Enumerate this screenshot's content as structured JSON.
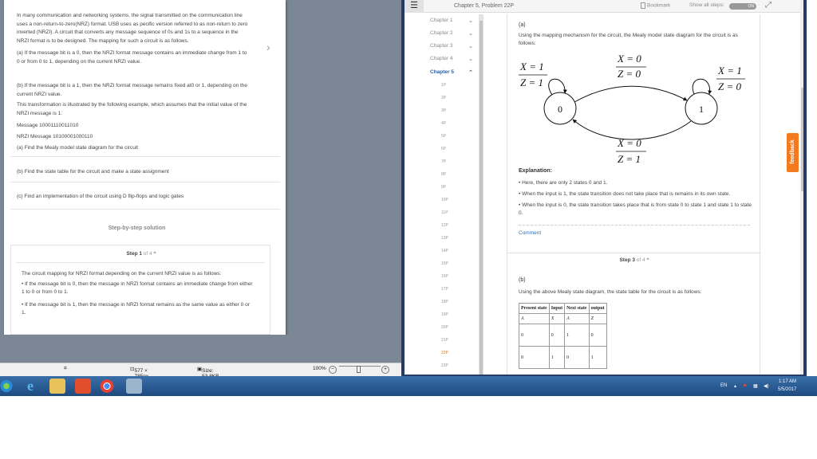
{
  "left_viewer": {
    "problem_text": {
      "intro": "In many communication and networking systems, the signal transmitted on the communication line uses a non-return-to-zero(NRZ) format. USB uses as pecific version referred to as non-return to zero inverted (NRZI). A circuit that converts any message sequence of 0s and 1s to a sequence in the NRZI format is to be designed. The mapping for such a circuit is as follows.",
      "part_a": "(a) If the message bit is a 0, then the NRZI format message contains an immediate change from 1 to 0 or from 0 to 1, depending on the current NRZI value.",
      "part_b": "(b) If the message bit is a 1, then the NRZI format message remains fixed at0 or 1, depending on the current NRZI value.",
      "illustration": "This transformation is illustrated by the following example, which assumes that the initial value of the NRZI message is 1:",
      "message": "Message 10001110011010",
      "nrzi_message": "NRZI Message  10100001000110",
      "question_a": "(a) Find the Mealy model state diagram for the circuit",
      "question_b": "(b) Find the state table for the circuit and make a state assignment",
      "question_c": "(c) Find an implementation of the circuit using D flip-flops and logic gates"
    },
    "solution_title": "Step-by-step solution",
    "step1": {
      "label": "Step 1",
      "of": "of 4",
      "p1": "The circuit mapping for NRZI format depending on the current NRZI value is as follows:",
      "p2": "• If the message bit is 0, then the message in NRZI format contains an immediate change from either 1 to 0 or from 0 to 1.",
      "p3": "• If the message bit is 1, then the message in NRZI format remains as the same value as either 0 or 1."
    },
    "status": {
      "dimensions": "577 × 785px",
      "size": "Size: 53.8KB",
      "zoom": "100%"
    }
  },
  "textbook": {
    "title": "Chapter 5, Problem 22P",
    "bookmark_label": "Bookmark",
    "show_all_steps_label": "Show all steps:",
    "toggle_label": "ON",
    "chapters": [
      "Chapter 1",
      "Chapter 2",
      "Chapter 3",
      "Chapter 4",
      "Chapter 5"
    ],
    "active_chapter": "Chapter 5",
    "problems": [
      "1P",
      "2P",
      "3P",
      "4P",
      "5P",
      "6P",
      "7P",
      "8P",
      "9P",
      "10P",
      "11P",
      "12P",
      "13P",
      "14P",
      "15P",
      "16P",
      "17P",
      "18P",
      "19P",
      "20P",
      "21P",
      "22P",
      "23P"
    ],
    "active_problem": "22P",
    "content": {
      "part_a_label": "(a)",
      "part_a_text": "Using the mapping mechanism for the circuit, the Mealy model state diagram for the circuit is as follows:",
      "diagram": {
        "state_0": "0",
        "state_1": "1",
        "self_loop_0_top": "X = 1",
        "self_loop_0_bottom": "Z = 1",
        "top_transition_top": "X = 0",
        "top_transition_bottom": "Z = 0",
        "self_loop_1_top": "X = 1",
        "self_loop_1_bottom": "Z = 0",
        "bottom_transition_top": "X = 0",
        "bottom_transition_bottom": "Z = 1"
      },
      "explanation_title": "Explanation:",
      "explanation_1": "• Here, there are only 2 states 0 and 1.",
      "explanation_2": "• When the input is 1, the state transition does not take place that is remains in its own state.",
      "explanation_3": "• When the input is 0, the state transition takes place that is from state 0 to state 1 and state 1 to state 0.",
      "comment_label": "Comment",
      "step3_label": "Step 3",
      "step3_of": "of 4",
      "part_b_label": "(b)",
      "part_b_text": "Using the above Mealy state diagram, the state table for the circuit is as follows:",
      "table": {
        "headers": [
          "Present state",
          "Input",
          "Next state",
          "output"
        ],
        "subheaders": [
          "A",
          "X",
          "A",
          "Z"
        ],
        "rows": [
          [
            "0",
            "0",
            "1",
            "0"
          ],
          [
            "0",
            "1",
            "0",
            "1"
          ]
        ]
      }
    },
    "feedback_label": "feedback"
  },
  "taskbar": {
    "language": "EN",
    "time": "1:17 AM",
    "date": "5/5/2017"
  },
  "colors": {
    "taskbar": "#2a5c94",
    "feedback": "#f47a1f",
    "link": "#2d6fb5",
    "active_problem": "#e07a00"
  }
}
